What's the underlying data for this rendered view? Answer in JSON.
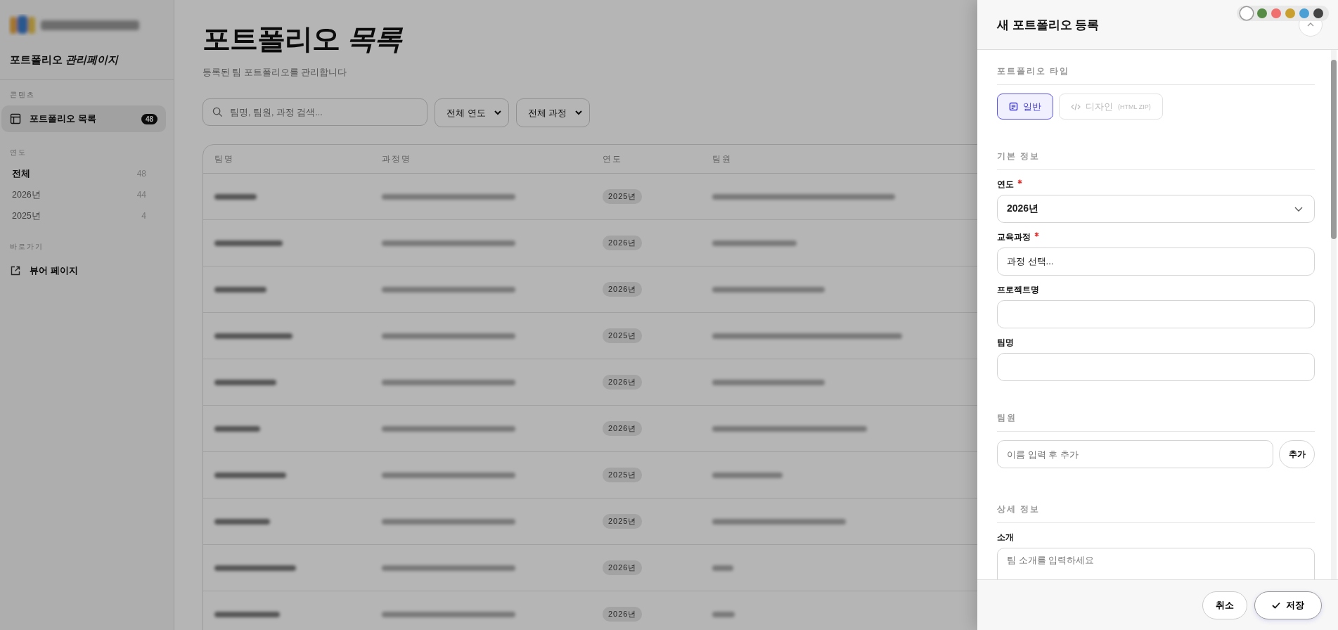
{
  "sidebar": {
    "title": "포트폴리오 *관리페이지*",
    "groups": [
      {
        "label": "콘텐츠",
        "items": [
          {
            "kind": "nav",
            "label": "포트폴리오 목록",
            "count": "48",
            "selected": true
          }
        ]
      },
      {
        "label": "연도",
        "items": [
          {
            "kind": "filter",
            "label": "전체",
            "count": "48",
            "selected": true
          },
          {
            "kind": "filter",
            "label": "2026년",
            "count": "44",
            "selected": false
          },
          {
            "kind": "filter",
            "label": "2025년",
            "count": "4",
            "selected": false
          }
        ]
      },
      {
        "label": "바로가기",
        "items": [
          {
            "kind": "nav",
            "label": "뷰어 페이지",
            "selected": false
          }
        ]
      }
    ]
  },
  "page": {
    "title": "포트폴리오 *목록*",
    "subtitle": "등록된 팀 포트폴리오를 관리합니다"
  },
  "filters": {
    "search": {
      "placeholder": "팀명, 팀원, 과정 검색..."
    },
    "selects": [
      "전체 연도",
      "전체 과정"
    ]
  },
  "table": {
    "columns": [
      "팀명",
      "과정명",
      "연도",
      "팀원"
    ],
    "rows": [
      {
        "year": "2025년"
      },
      {
        "year": "2026년"
      },
      {
        "year": "2026년"
      },
      {
        "year": "2025년"
      },
      {
        "year": "2026년"
      },
      {
        "year": "2026년"
      },
      {
        "year": "2025년"
      },
      {
        "year": "2025년"
      },
      {
        "year": "2026년"
      },
      {
        "year": "2026년"
      }
    ]
  },
  "palette": [
    {
      "color": "#ffffff",
      "selected": true
    },
    {
      "color": "#558b45",
      "selected": false
    },
    {
      "color": "#f07070",
      "selected": false
    },
    {
      "color": "#c9a030",
      "selected": false
    },
    {
      "color": "#4aa0d5",
      "selected": false
    },
    {
      "color": "#444444",
      "selected": false
    }
  ],
  "drawer": {
    "title": "새 포트폴리오 등록",
    "type_section": {
      "heading": "포트폴리오 타입",
      "options": [
        {
          "label": "일반",
          "selected": true
        },
        {
          "label": "디자인",
          "note": "(HTML ZIP)",
          "selected": false
        }
      ]
    },
    "basic_section": {
      "heading": "기본 정보",
      "fields": [
        {
          "kind": "select",
          "label": "연도",
          "required": true,
          "value": "2026년"
        },
        {
          "kind": "select-text",
          "label": "교육과정",
          "required": true,
          "value": "과정 선택..."
        },
        {
          "kind": "text",
          "label": "프로젝트명",
          "required": false
        },
        {
          "kind": "text",
          "label": "팀명",
          "required": false
        }
      ]
    },
    "members_section": {
      "heading": "팀원",
      "placeholder": "이름 입력 후 추가",
      "add_button": "추가"
    },
    "detail_section": {
      "heading": "상세 정보",
      "label": "소개",
      "placeholder": "팀 소개를 입력하세요"
    },
    "buttons": {
      "cancel": "취소",
      "save": "저장"
    }
  }
}
